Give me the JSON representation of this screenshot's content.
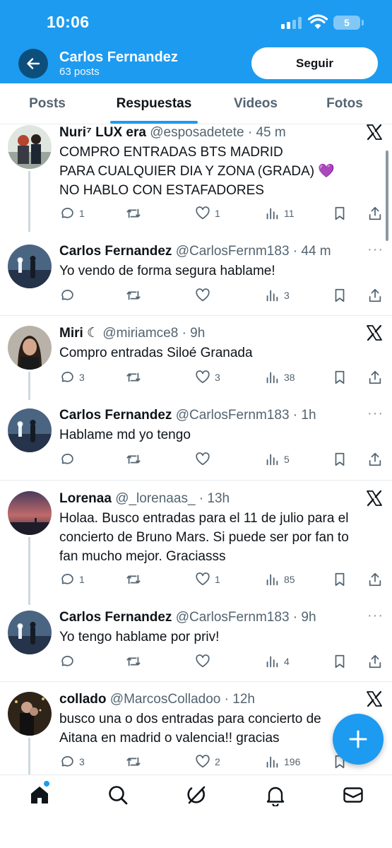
{
  "status_bar": {
    "time": "10:06",
    "battery": "5"
  },
  "header": {
    "back_label": "←",
    "name": "Carlos Fernandez",
    "posts_count": "63 posts",
    "follow_label": "Seguir"
  },
  "tabs": [
    {
      "label": "Posts",
      "active": false
    },
    {
      "label": "Respuestas",
      "active": true
    },
    {
      "label": "Videos",
      "active": false
    },
    {
      "label": "Fotos",
      "active": false
    }
  ],
  "posts": [
    {
      "name": "Nuri⁷ LUX era",
      "handle": "@esposadetete · 45 m",
      "lines": [
        "COMPRO ENTRADAS BTS MADRID",
        "PARA CUALQUIER DIA Y ZONA (GRADA) 💜",
        "NO HABLO CON ESTAFADORES"
      ],
      "replies": "1",
      "reposts": "",
      "likes": "1",
      "views": "11"
    },
    {
      "name": "Carlos Fernandez",
      "handle": "@CarlosFernm183 · 44 m",
      "lines": [
        "Yo vendo de forma segura hablame!"
      ],
      "replies": "",
      "reposts": "",
      "likes": "",
      "views": "3"
    },
    {
      "name": "Miri ☾",
      "handle": "@miriamce8 · 9h",
      "lines": [
        "Compro entradas Siloé Granada"
      ],
      "replies": "3",
      "reposts": "",
      "likes": "3",
      "views": "38"
    },
    {
      "name": "Carlos Fernandez",
      "handle": "@CarlosFernm183 · 1h",
      "lines": [
        "Hablame md yo tengo"
      ],
      "replies": "",
      "reposts": "",
      "likes": "",
      "views": "5"
    },
    {
      "name": "Lorenaa",
      "handle": "@_lorenaas_ · 13h",
      "lines": [
        "Holaa. Busco entradas para el 11 de julio para el",
        "concierto de Bruno Mars. Si puede ser por fan to",
        "fan mucho mejor. Graciasss"
      ],
      "replies": "1",
      "reposts": "",
      "likes": "1",
      "views": "85"
    },
    {
      "name": "Carlos Fernandez",
      "handle": "@CarlosFernm183 · 9h",
      "lines": [
        "Yo tengo hablame por priv!"
      ],
      "replies": "",
      "reposts": "",
      "likes": "",
      "views": "4"
    },
    {
      "name": "collado",
      "handle": "@MarcosColladoo · 12h",
      "lines": [
        "busco una o dos entradas para concierto de",
        "Aitana en madrid o valencia!! gracias"
      ],
      "replies": "3",
      "reposts": "",
      "likes": "2",
      "views": "196"
    }
  ],
  "icons": {
    "accent": "#1d9bf0",
    "nav": [
      "home-icon",
      "search-icon",
      "grok-icon",
      "notifications-icon",
      "messages-icon"
    ]
  }
}
